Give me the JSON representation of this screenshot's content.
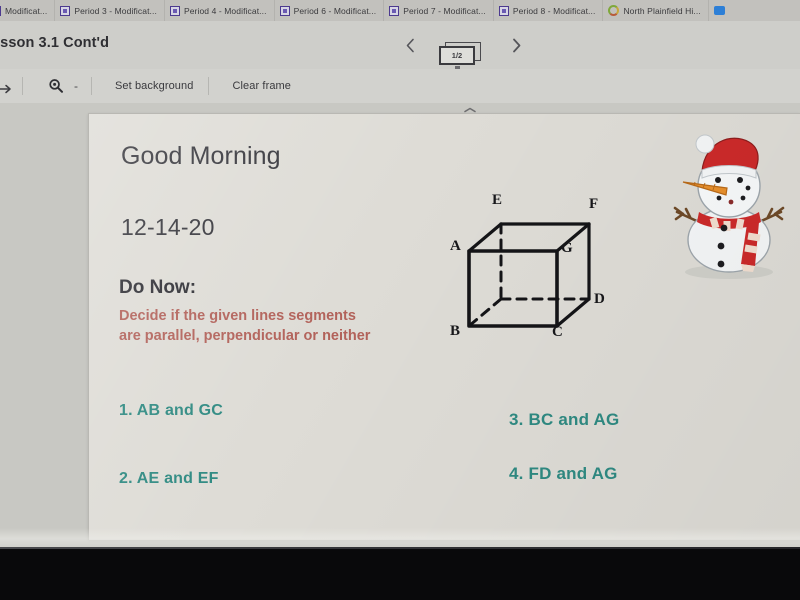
{
  "browser": {
    "tabs": [
      {
        "label": "Modificat...",
        "icon": "classroom-icon",
        "truncated_left": true
      },
      {
        "label": "Period 3 - Modificat...",
        "icon": "classroom-icon"
      },
      {
        "label": "Period 4 - Modificat...",
        "icon": "classroom-icon"
      },
      {
        "label": "Period 6 - Modificat...",
        "icon": "classroom-icon"
      },
      {
        "label": "Period 7 - Modificat...",
        "icon": "classroom-icon"
      },
      {
        "label": "Period 8 - Modificat...",
        "icon": "classroom-icon"
      },
      {
        "label": "North Plainfield Hi...",
        "icon": "google-icon"
      },
      {
        "label": "",
        "icon": "window-icon"
      }
    ]
  },
  "header": {
    "document_title": "esson 3.1 Cont'd",
    "prev_icon": "chevron-left-icon",
    "next_icon": "chevron-right-icon",
    "page_indicator": "1/2",
    "page_indicator_icon": "slide-stack-icon"
  },
  "toolbar": {
    "redo_icon": "redo-arrow-icon",
    "zoom_icon": "magnifier-icon",
    "zoom_value": "-",
    "set_background_label": "Set background",
    "clear_frame_label": "Clear frame",
    "collapse_icon": "chevron-collapse-icon"
  },
  "slide": {
    "greeting": "Good Morning",
    "date": "12-14-20",
    "do_now_title": "Do Now:",
    "do_now_line1": "Decide if the given lines segments",
    "do_now_line2": "are parallel, perpendicular or neither",
    "questions_left": [
      "1. AB and GC",
      "2. AE and EF"
    ],
    "questions_right": [
      "3. BC and AG",
      "4. FD and AG"
    ],
    "figure": {
      "name": "cube-diagram",
      "vertices": [
        "E",
        "F",
        "A",
        "G",
        "D",
        "B",
        "C"
      ]
    },
    "image": {
      "name": "snowman-illustration",
      "description": "snowman with santa hat and striped scarf"
    }
  },
  "colors": {
    "heading_text": "#34343a",
    "do_now_body": "#b2625a",
    "question_text": "#2f8a82",
    "slide_background": "#dedcd6",
    "santa_hat_red": "#cc2a2a"
  }
}
